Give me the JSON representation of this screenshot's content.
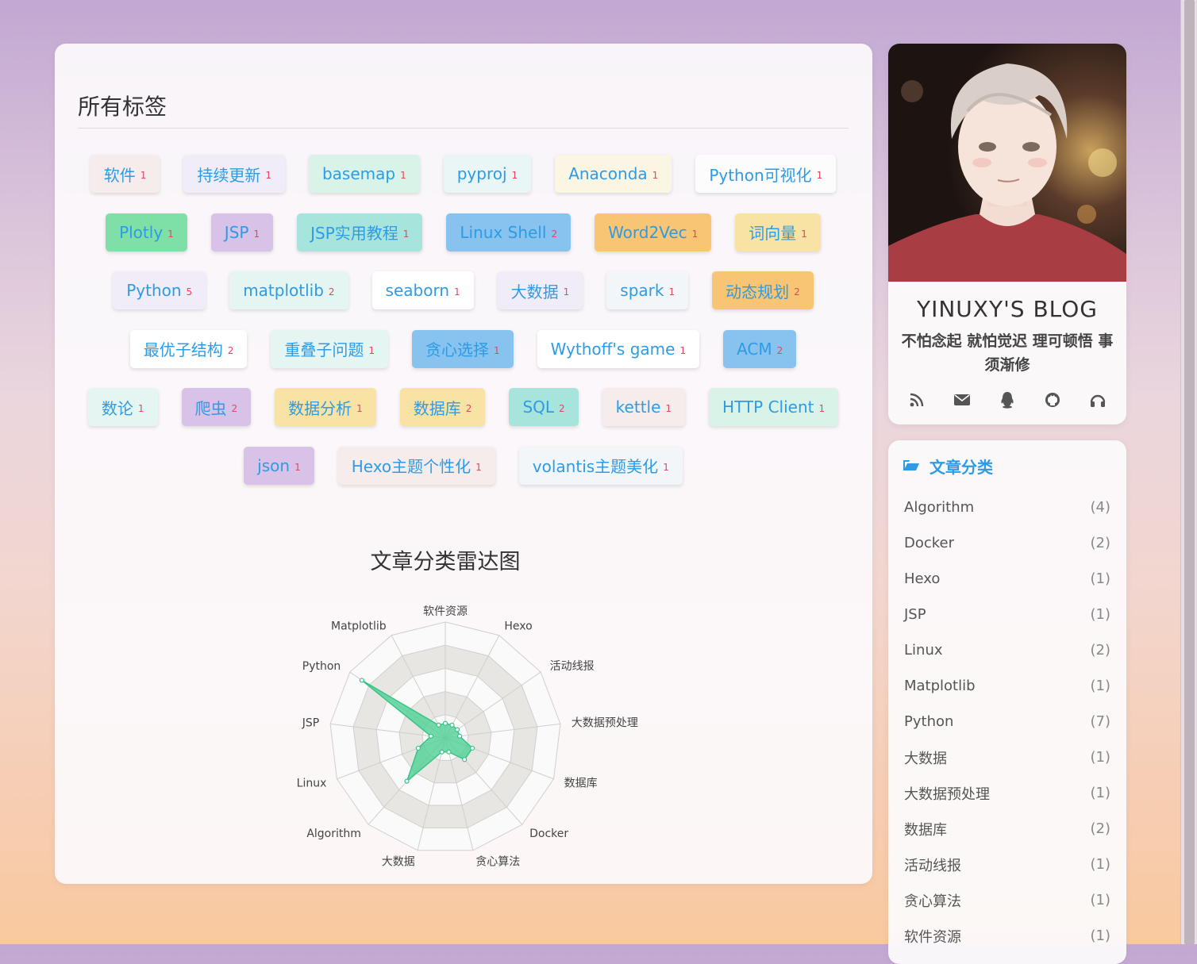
{
  "tags_page": {
    "title": "所有标签",
    "rows": [
      [
        {
          "name": "软件",
          "count": "1",
          "bg": "#f6ecec"
        },
        {
          "name": "持续更新",
          "count": "1",
          "bg": "#f0ecf8"
        },
        {
          "name": "basemap",
          "count": "1",
          "bg": "#d9f3e9"
        },
        {
          "name": "pyproj",
          "count": "1",
          "bg": "#eaf6f6"
        },
        {
          "name": "Anaconda",
          "count": "1",
          "bg": "#fbf6e3"
        },
        {
          "name": "Python可视化",
          "count": "1",
          "bg": "#fcfcfc"
        }
      ],
      [
        {
          "name": "Plotly",
          "count": "1",
          "bg": "#7fe0a7"
        },
        {
          "name": "JSP",
          "count": "1",
          "bg": "#d8c2e7"
        },
        {
          "name": "JSP实用教程",
          "count": "1",
          "bg": "#a7e5dc"
        },
        {
          "name": "Linux Shell",
          "count": "2",
          "bg": "#87c3ee"
        },
        {
          "name": "Word2Vec",
          "count": "1",
          "bg": "#f7c574"
        },
        {
          "name": "词向量",
          "count": "1",
          "bg": "#f9e3a4"
        }
      ],
      [
        {
          "name": "Python",
          "count": "5",
          "bg": "#f0ecf8"
        },
        {
          "name": "matplotlib",
          "count": "2",
          "bg": "#e4f5f2"
        },
        {
          "name": "seaborn",
          "count": "1",
          "bg": "#ffffff"
        },
        {
          "name": "大数据",
          "count": "1",
          "bg": "#f0ecf8"
        },
        {
          "name": "spark",
          "count": "1",
          "bg": "#f2f6f8"
        },
        {
          "name": "动态规划",
          "count": "2",
          "bg": "#f7c574"
        }
      ],
      [
        {
          "name": "最优子结构",
          "count": "2",
          "bg": "#ffffff"
        },
        {
          "name": "重叠子问题",
          "count": "1",
          "bg": "#e4f5f2"
        },
        {
          "name": "贪心选择",
          "count": "1",
          "bg": "#87c3ee"
        },
        {
          "name": "Wythoff's game",
          "count": "1",
          "bg": "#ffffff"
        },
        {
          "name": "ACM",
          "count": "2",
          "bg": "#87c3ee"
        }
      ],
      [
        {
          "name": "数论",
          "count": "1",
          "bg": "#e4f5f2"
        },
        {
          "name": "爬虫",
          "count": "2",
          "bg": "#d8c2e7"
        },
        {
          "name": "数据分析",
          "count": "1",
          "bg": "#f9e3a4"
        },
        {
          "name": "数据库",
          "count": "2",
          "bg": "#f9e3a4"
        },
        {
          "name": "SQL",
          "count": "2",
          "bg": "#a7e5dc"
        },
        {
          "name": "kettle",
          "count": "1",
          "bg": "#f6ecec"
        },
        {
          "name": "HTTP Client",
          "count": "1",
          "bg": "#d9f3e9"
        }
      ],
      [
        {
          "name": "json",
          "count": "1",
          "bg": "#d8c2e7"
        },
        {
          "name": "Hexo主题个性化",
          "count": "1",
          "bg": "#f6ecec"
        },
        {
          "name": "volantis主题美化",
          "count": "1",
          "bg": "#f2f6f8"
        }
      ]
    ]
  },
  "chart_data": {
    "type": "radar",
    "title": "文章分类雷达图",
    "indicators": [
      "软件资源",
      "Hexo",
      "活动线报",
      "大数据预处理",
      "数据库",
      "Docker",
      "贪心算法",
      "大数据",
      "Algorithm",
      "Linux",
      "JSP",
      "Python",
      "Matplotlib"
    ],
    "values": [
      1,
      1,
      1,
      1,
      2,
      2,
      1,
      1,
      4,
      2,
      1,
      7,
      1
    ],
    "max": 8,
    "color": "#4fd195"
  },
  "profile": {
    "blog_title": "YINUXY'S BLOG",
    "motto": "不怕念起 就怕觉迟 理可顿悟 事须渐修",
    "social_icons": [
      "rss-icon",
      "email-icon",
      "qq-icon",
      "github-icon",
      "headphones-icon"
    ]
  },
  "categories": {
    "header": "文章分类",
    "icon": "folder-open-icon",
    "items": [
      {
        "name": "Algorithm",
        "count": "(4)"
      },
      {
        "name": "Docker",
        "count": "(2)"
      },
      {
        "name": "Hexo",
        "count": "(1)"
      },
      {
        "name": "JSP",
        "count": "(1)"
      },
      {
        "name": "Linux",
        "count": "(2)"
      },
      {
        "name": "Matplotlib",
        "count": "(1)"
      },
      {
        "name": "Python",
        "count": "(7)"
      },
      {
        "name": "大数据",
        "count": "(1)"
      },
      {
        "name": "大数据预处理",
        "count": "(1)"
      },
      {
        "name": "数据库",
        "count": "(2)"
      },
      {
        "name": "活动线报",
        "count": "(1)"
      },
      {
        "name": "贪心算法",
        "count": "(1)"
      },
      {
        "name": "软件资源",
        "count": "(1)"
      }
    ]
  },
  "colors": {
    "accent": "#2e9be4",
    "count": "#e2475e",
    "radar_fill": "#4fd195"
  }
}
